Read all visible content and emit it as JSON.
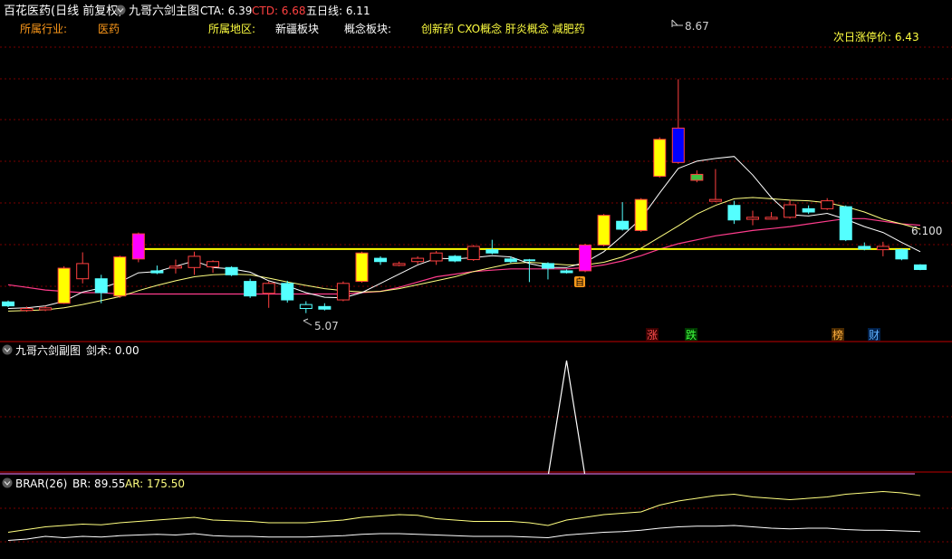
{
  "header": {
    "stock_title": "百花医药(日线 前复权)",
    "indicator_name": "九哥六剑主图",
    "cta_label": "CTA: 6.39",
    "ctd_label": "CTD: 6.68",
    "ma5_label": "五日线: 6.11"
  },
  "info": {
    "industry_label": "所属行业:",
    "industry_value": "医药",
    "region_label": "所属地区:",
    "region_value": "新疆板块",
    "concept_label": "概念板块:",
    "concept_value": "创新药 CXO概念 肝炎概念 减肥药",
    "limit_label": "次日涨停价: 6.43"
  },
  "markers": {
    "high_label": "8.67",
    "low_label": "5.07",
    "line_label": "6.100",
    "tag_zhang": "涨",
    "tag_die": "跌",
    "tag_bang": "榜",
    "tag_cai": "财",
    "tag_zi": "自"
  },
  "sub1": {
    "title": "九哥六剑副图",
    "value_label": "剑术: 0.00"
  },
  "sub2": {
    "title": "BRAR(26)",
    "br_label": "BR: 89.55",
    "ar_label": "AR: 175.50"
  },
  "colors": {
    "up": "#ff4040",
    "down": "#54ffff",
    "yellow": "#ffff00",
    "magenta": "#ff00ff",
    "blue": "#0000ff",
    "ma_white": "#ffffff",
    "ma_yellow": "#ffff80",
    "ma_pink": "#ff3c8c",
    "grid": "#7a0000",
    "divider": "#c00000"
  },
  "chart_data": {
    "type": "candlestick",
    "reference_price": 6.1,
    "highest": 8.67,
    "lowest": 5.07,
    "candles": [
      {
        "o": 5.3,
        "c": 5.24,
        "h": 5.32,
        "l": 5.22,
        "k": "down"
      },
      {
        "o": 5.2,
        "c": 5.17,
        "h": 5.23,
        "l": 5.15,
        "k": "up_hollow"
      },
      {
        "o": 5.18,
        "c": 5.21,
        "h": 5.24,
        "l": 5.16,
        "k": "up_hollow"
      },
      {
        "o": 5.28,
        "c": 5.81,
        "h": 5.84,
        "l": 5.27,
        "k": "yellow"
      },
      {
        "o": 5.65,
        "c": 5.88,
        "h": 6.05,
        "l": 5.58,
        "k": "up_hollow"
      },
      {
        "o": 5.65,
        "c": 5.44,
        "h": 5.71,
        "l": 5.28,
        "k": "down"
      },
      {
        "o": 5.39,
        "c": 5.98,
        "h": 6.0,
        "l": 5.36,
        "k": "yellow"
      },
      {
        "o": 5.95,
        "c": 6.33,
        "h": 6.35,
        "l": 5.9,
        "k": "magenta"
      },
      {
        "o": 5.77,
        "c": 5.74,
        "h": 5.85,
        "l": 5.72,
        "k": "down"
      },
      {
        "o": 5.84,
        "c": 5.84,
        "h": 5.94,
        "l": 5.73,
        "k": "up_hollow"
      },
      {
        "o": 5.82,
        "c": 5.99,
        "h": 6.06,
        "l": 5.71,
        "k": "up_hollow"
      },
      {
        "o": 5.91,
        "c": 5.83,
        "h": 5.93,
        "l": 5.74,
        "k": "up_hollow"
      },
      {
        "o": 5.82,
        "c": 5.71,
        "h": 5.84,
        "l": 5.69,
        "k": "down"
      },
      {
        "o": 5.61,
        "c": 5.39,
        "h": 5.65,
        "l": 5.36,
        "k": "down"
      },
      {
        "o": 5.43,
        "c": 5.58,
        "h": 5.61,
        "l": 5.21,
        "k": "up_hollow"
      },
      {
        "o": 5.58,
        "c": 5.33,
        "h": 5.62,
        "l": 5.29,
        "k": "down"
      },
      {
        "o": 5.26,
        "c": 5.2,
        "h": 5.31,
        "l": 5.13,
        "k": "down_hollow"
      },
      {
        "o": 5.23,
        "c": 5.19,
        "h": 5.28,
        "l": 5.17,
        "k": "down"
      },
      {
        "o": 5.33,
        "c": 5.58,
        "h": 5.61,
        "l": 5.31,
        "k": "up_hollow"
      },
      {
        "o": 5.61,
        "c": 6.04,
        "h": 6.06,
        "l": 5.59,
        "k": "yellow"
      },
      {
        "o": 5.96,
        "c": 5.91,
        "h": 5.99,
        "l": 5.86,
        "k": "down"
      },
      {
        "o": 5.88,
        "c": 5.86,
        "h": 5.91,
        "l": 5.84,
        "k": "up_hollow"
      },
      {
        "o": 5.91,
        "c": 5.96,
        "h": 5.99,
        "l": 5.87,
        "k": "up_hollow"
      },
      {
        "o": 5.92,
        "c": 6.04,
        "h": 6.07,
        "l": 5.86,
        "k": "up_hollow"
      },
      {
        "o": 5.99,
        "c": 5.92,
        "h": 6.01,
        "l": 5.9,
        "k": "down"
      },
      {
        "o": 5.94,
        "c": 6.14,
        "h": 6.16,
        "l": 5.92,
        "k": "up_hollow"
      },
      {
        "o": 6.09,
        "c": 6.04,
        "h": 6.24,
        "l": 6.02,
        "k": "down"
      },
      {
        "o": 5.95,
        "c": 5.91,
        "h": 5.99,
        "l": 5.89,
        "k": "down"
      },
      {
        "o": 5.93,
        "c": 5.85,
        "h": 5.95,
        "l": 5.6,
        "k": "down_thin"
      },
      {
        "o": 5.88,
        "c": 5.81,
        "h": 5.9,
        "l": 5.64,
        "k": "down"
      },
      {
        "o": 5.77,
        "c": 5.76,
        "h": 5.79,
        "l": 5.73,
        "k": "down"
      },
      {
        "o": 5.77,
        "c": 6.16,
        "h": 6.18,
        "l": 5.75,
        "k": "magenta"
      },
      {
        "o": 6.16,
        "c": 6.61,
        "h": 6.63,
        "l": 6.14,
        "k": "yellow"
      },
      {
        "o": 6.4,
        "c": 6.52,
        "h": 6.81,
        "l": 6.38,
        "k": "down"
      },
      {
        "o": 6.38,
        "c": 6.85,
        "h": 6.87,
        "l": 6.36,
        "k": "yellow"
      },
      {
        "o": 7.2,
        "c": 7.76,
        "h": 7.79,
        "l": 7.18,
        "k": "yellow"
      },
      {
        "o": 7.41,
        "c": 7.93,
        "h": 8.67,
        "l": 7.39,
        "k": "blue"
      },
      {
        "o": 7.23,
        "c": 7.14,
        "h": 7.29,
        "l": 7.11,
        "k": "green"
      },
      {
        "o": 6.85,
        "c": 6.83,
        "h": 7.31,
        "l": 6.81,
        "k": "up_hollow"
      },
      {
        "o": 6.76,
        "c": 6.54,
        "h": 6.83,
        "l": 6.48,
        "k": "down"
      },
      {
        "o": 6.58,
        "c": 6.55,
        "h": 6.68,
        "l": 6.46,
        "k": "up_hollow"
      },
      {
        "o": 6.58,
        "c": 6.58,
        "h": 6.66,
        "l": 6.55,
        "k": "up_hollow"
      },
      {
        "o": 6.58,
        "c": 6.77,
        "h": 6.84,
        "l": 6.56,
        "k": "up_hollow"
      },
      {
        "o": 6.71,
        "c": 6.66,
        "h": 6.76,
        "l": 6.63,
        "k": "down"
      },
      {
        "o": 6.71,
        "c": 6.83,
        "h": 6.87,
        "l": 6.69,
        "k": "up_hollow"
      },
      {
        "o": 6.74,
        "c": 6.24,
        "h": 6.76,
        "l": 6.22,
        "k": "down"
      },
      {
        "o": 6.14,
        "c": 6.1,
        "h": 6.2,
        "l": 6.08,
        "k": "down"
      },
      {
        "o": 6.09,
        "c": 6.14,
        "h": 6.21,
        "l": 5.99,
        "k": "up_hollow"
      },
      {
        "o": 6.09,
        "c": 5.95,
        "h": 6.11,
        "l": 5.93,
        "k": "down"
      },
      {
        "o": 5.86,
        "c": 5.79,
        "h": 5.87,
        "l": 5.78,
        "k": "down"
      }
    ],
    "ma5": [
      5.2,
      5.21,
      5.24,
      5.31,
      5.45,
      5.51,
      5.6,
      5.74,
      5.76,
      5.84,
      5.92,
      5.82,
      5.8,
      5.75,
      5.62,
      5.54,
      5.44,
      5.37,
      5.36,
      5.44,
      5.58,
      5.72,
      5.86,
      5.96,
      5.95,
      5.97,
      6.0,
      5.98,
      5.88,
      5.82,
      5.82,
      5.9,
      6.06,
      6.3,
      6.56,
      6.95,
      7.32,
      7.43,
      7.47,
      7.5,
      7.22,
      6.88,
      6.62,
      6.6,
      6.64,
      6.55,
      6.44,
      6.35,
      6.2,
      6.06
    ],
    "ma10": [
      5.16,
      5.17,
      5.18,
      5.21,
      5.26,
      5.32,
      5.38,
      5.47,
      5.55,
      5.62,
      5.68,
      5.71,
      5.72,
      5.71,
      5.66,
      5.6,
      5.55,
      5.5,
      5.47,
      5.45,
      5.46,
      5.5,
      5.56,
      5.62,
      5.68,
      5.76,
      5.82,
      5.88,
      5.9,
      5.88,
      5.86,
      5.86,
      5.9,
      5.98,
      6.11,
      6.28,
      6.45,
      6.63,
      6.76,
      6.86,
      6.88,
      6.86,
      6.84,
      6.83,
      6.8,
      6.74,
      6.66,
      6.55,
      6.48,
      6.4
    ],
    "ma_long": [
      5.56,
      5.52,
      5.48,
      5.46,
      5.44,
      5.44,
      5.42,
      5.42,
      5.42,
      5.42,
      5.42,
      5.42,
      5.42,
      5.42,
      5.42,
      5.42,
      5.42,
      5.42,
      5.42,
      5.44,
      5.46,
      5.52,
      5.6,
      5.68,
      5.72,
      5.76,
      5.78,
      5.8,
      5.8,
      5.8,
      5.8,
      5.82,
      5.86,
      5.92,
      6.0,
      6.1,
      6.18,
      6.24,
      6.3,
      6.34,
      6.38,
      6.41,
      6.44,
      6.48,
      6.52,
      6.56,
      6.56,
      6.52,
      6.48,
      6.46
    ],
    "sub1_series": {
      "name": "剑术",
      "peak_index": 30,
      "peak_value": 1.0,
      "base_value": 0.0
    },
    "br_series": [
      30,
      34,
      38,
      40,
      42,
      41,
      44,
      46,
      48,
      50,
      52,
      48,
      47,
      46,
      44,
      44,
      44,
      46,
      48,
      52,
      54,
      56,
      55,
      50,
      48,
      46,
      46,
      46,
      44,
      40,
      48,
      52,
      56,
      58,
      60,
      70,
      76,
      80,
      84,
      86,
      82,
      80,
      78,
      80,
      82,
      86,
      88,
      90,
      88,
      84
    ],
    "ar_series": [
      18,
      20,
      24,
      22,
      24,
      23,
      25,
      26,
      27,
      26,
      28,
      25,
      24,
      24,
      23,
      23,
      23,
      24,
      25,
      27,
      28,
      28,
      27,
      26,
      25,
      24,
      24,
      24,
      23,
      22,
      26,
      28,
      30,
      31,
      33,
      36,
      38,
      39,
      39,
      40,
      38,
      36,
      35,
      36,
      36,
      34,
      33,
      33,
      32,
      31
    ]
  }
}
